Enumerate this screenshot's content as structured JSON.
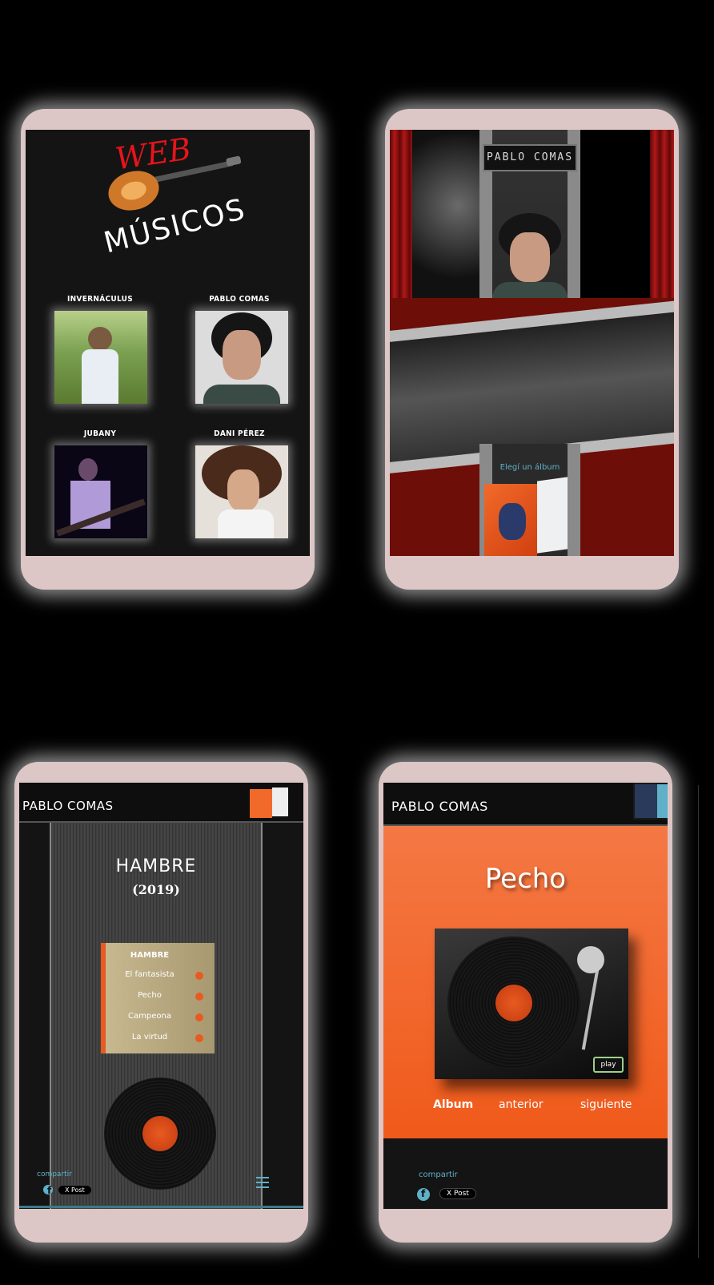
{
  "screen1": {
    "logo": {
      "word_top": "WEB",
      "word_bottom": "MÚSICOS"
    },
    "artists": [
      {
        "name": "INVERNÁCULUS"
      },
      {
        "name": "PABLO COMAS"
      },
      {
        "name": "JUBANY"
      },
      {
        "name": "DANI PÉREZ"
      }
    ]
  },
  "screen2": {
    "sign": "PABLO COMAS",
    "album_prompt": "Elegí un álbum"
  },
  "screen3": {
    "header_title": "PABLO COMAS",
    "album_title": "HAMBRE",
    "album_year": "(2019)",
    "tracklist_heading": "HAMBRE",
    "tracks": [
      "El fantasista",
      "Pecho",
      "Campeona",
      "La virtud"
    ],
    "share_label": "compartir",
    "xpost_label": "X Post"
  },
  "screen4": {
    "header_title": "PABLO COMAS",
    "song_title": "Pecho",
    "play_label": "play",
    "nav": {
      "album": "Album",
      "prev": "anterior",
      "next": "siguiente"
    },
    "share_label": "compartir",
    "xpost_label": "X Post"
  },
  "colors": {
    "device": "#dcc6c6",
    "accent_cyan": "#5fb0c8",
    "orange": "#f26a2a"
  }
}
